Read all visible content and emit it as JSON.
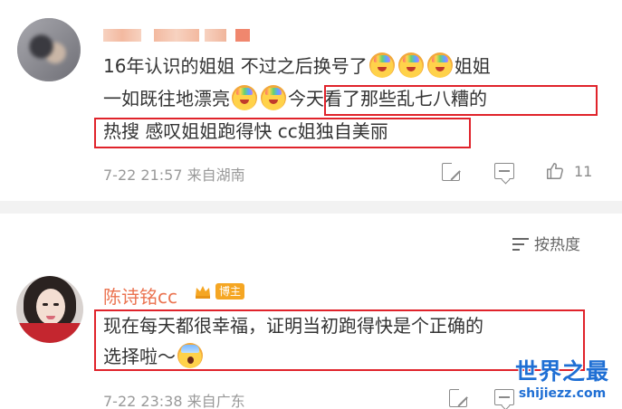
{
  "comments": [
    {
      "lines": [
        "16年认识的姐姐 不过之后换号了",
        "姐姐",
        "一如既往地漂亮",
        "今天看了那些乱七八糟的",
        "热搜 感叹姐姐跑得快 cc姐独自美丽"
      ],
      "date": "7-22",
      "time": "21:57",
      "source": "来自湖南",
      "like_count": "11"
    },
    {
      "author": "陈诗铭cc",
      "badge": "博主",
      "lines": [
        "现在每天都很幸福，证明当初跑得快是个正确的",
        "选择啦～"
      ],
      "date": "7-22",
      "time": "23:38",
      "source": "来自广东"
    }
  ],
  "sort": {
    "label": "按热度"
  },
  "icons": [
    "share-icon",
    "comment-icon",
    "like-icon",
    "sort-icon",
    "crown-icon",
    "avatar",
    "emoji"
  ],
  "watermark": {
    "title": "世界之最",
    "url": "shijiezz.com"
  },
  "colors": {
    "highlight_box": "#e0232b",
    "author_name": "#eb7350",
    "badge": "#f5a623",
    "meta": "#999999",
    "watermark": "#1f6fd4"
  }
}
